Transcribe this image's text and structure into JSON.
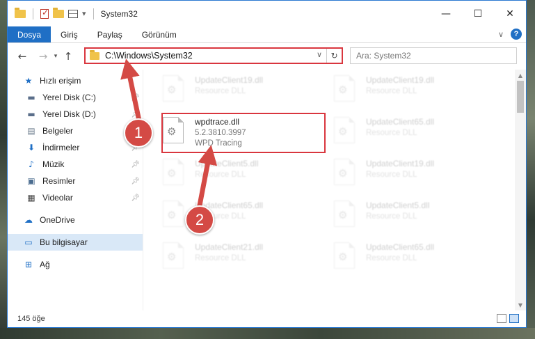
{
  "window": {
    "title": "System32",
    "controls": {
      "minimize": "—",
      "maximize": "☐",
      "close": "✕"
    }
  },
  "ribbon": {
    "tabs": [
      "Dosya",
      "Giriş",
      "Paylaş",
      "Görünüm"
    ],
    "active_tab": "Dosya",
    "help": "?"
  },
  "address_bar": {
    "path": "C:\\Windows\\System32",
    "search_placeholder": "Ara: System32"
  },
  "navigation": {
    "quick_access": "Hızlı erişim",
    "items": [
      {
        "label": "Yerel Disk (C:)",
        "icon": "drive-icon",
        "pinned": true
      },
      {
        "label": "Yerel Disk (D:)",
        "icon": "drive-icon",
        "pinned": true
      },
      {
        "label": "Belgeler",
        "icon": "documents-icon",
        "pinned": true
      },
      {
        "label": "İndirmeler",
        "icon": "downloads-icon",
        "pinned": true
      },
      {
        "label": "Müzik",
        "icon": "music-icon",
        "pinned": true
      },
      {
        "label": "Resimler",
        "icon": "pictures-icon",
        "pinned": true
      },
      {
        "label": "Videolar",
        "icon": "videos-icon",
        "pinned": true
      }
    ],
    "onedrive": "OneDrive",
    "this_pc": "Bu bilgisayar",
    "network": "Ağ"
  },
  "files": {
    "highlighted": {
      "name": "wpdtrace.dll",
      "version": "5.2.3810.3997",
      "description": "WPD Tracing"
    },
    "background": [
      {
        "name": "UpdateClient19.dll",
        "desc": "Resource DLL"
      },
      {
        "name": "UpdateClient19.dll",
        "desc": "Resource DLL"
      },
      {
        "name": "UpdateClient65.dll",
        "desc": "Resource DLL"
      },
      {
        "name": "UpdateClient5.dll",
        "desc": "Resource DLL"
      },
      {
        "name": "UpdateClient19.dll",
        "desc": "Resource DLL"
      },
      {
        "name": "UpdateClient65.dll",
        "desc": "Resource DLL"
      },
      {
        "name": "UpdateClient5.dll",
        "desc": "Resource DLL"
      },
      {
        "name": "UpdateClient21.dll",
        "desc": "Resource DLL"
      },
      {
        "name": "UpdateClient65.dll",
        "desc": "Resource DLL"
      }
    ]
  },
  "status": {
    "item_count": "145 öğe"
  },
  "annotations": {
    "step1": "1",
    "step2": "2",
    "color": "#d44a45"
  }
}
